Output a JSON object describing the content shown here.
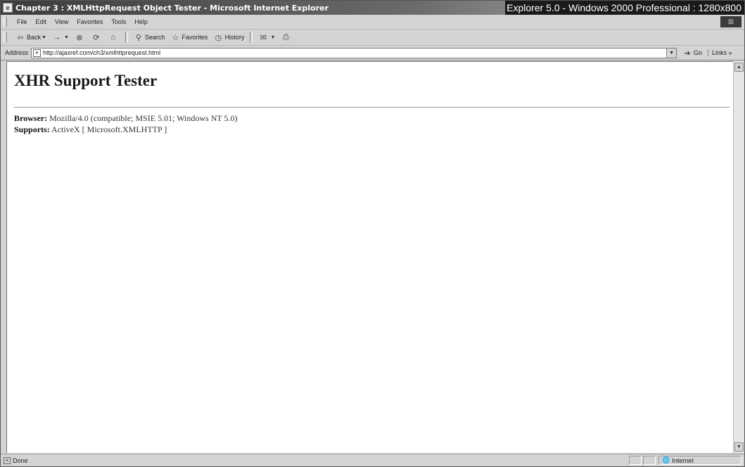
{
  "window": {
    "title": "Chapter 3 : XMLHttpRequest Object Tester - Microsoft Internet Explorer",
    "overlay_label": "Explorer 5.0 - Windows 2000 Professional : 1280x800"
  },
  "menu": {
    "items": [
      "File",
      "Edit",
      "View",
      "Favorites",
      "Tools",
      "Help"
    ]
  },
  "toolbar": {
    "back_label": "Back",
    "search_label": "Search",
    "favorites_label": "Favorites",
    "history_label": "History"
  },
  "address": {
    "label": "Address",
    "url": "http://ajaxref.com/ch3/xmlhttprequest.html",
    "go_label": "Go",
    "links_label": "Links »"
  },
  "page": {
    "title": "XHR Support Tester",
    "browser_label": "Browser:",
    "browser_value": "Mozilla/4.0 (compatible; MSIE 5.01; Windows NT 5.0)",
    "supports_label": "Supports:",
    "supports_value": "ActiveX [ Microsoft.XMLHTTP ]"
  },
  "status": {
    "text": "Done",
    "zone": "Internet"
  },
  "icons": {
    "app": "ie-icon",
    "back": "back-arrow-icon",
    "forward": "forward-arrow-icon",
    "stop": "stop-icon",
    "refresh": "refresh-icon",
    "home": "home-icon",
    "search": "search-icon",
    "favorites": "favorites-icon",
    "history": "history-icon",
    "mail": "mail-icon",
    "print": "print-icon"
  }
}
